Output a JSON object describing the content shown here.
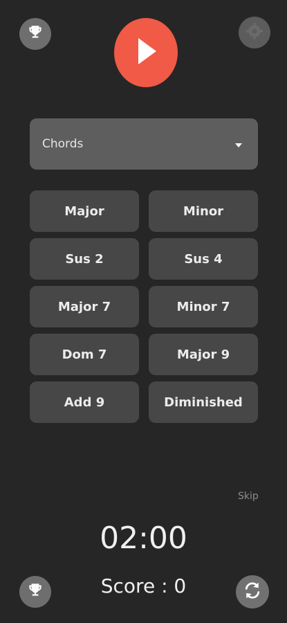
{
  "icons": {
    "trophy": "trophy-icon",
    "settings": "gear-icon",
    "play": "play-icon",
    "dropdown": "caret-down-icon",
    "replay": "refresh-icon"
  },
  "colors": {
    "background": "#262626",
    "play_button": "#f05a46",
    "select_bg": "#5e5e5e",
    "chord_button_bg": "#474747"
  },
  "mode_select": {
    "selected": "Chords"
  },
  "chords": [
    "Major",
    "Minor",
    "Sus 2",
    "Sus 4",
    "Major 7",
    "Minor 7",
    "Dom 7",
    "Major 9",
    "Add 9",
    "Diminished"
  ],
  "skip_label": "Skip",
  "timer": "02:00",
  "score": {
    "label": "Score",
    "separator": " : ",
    "value": "0"
  }
}
